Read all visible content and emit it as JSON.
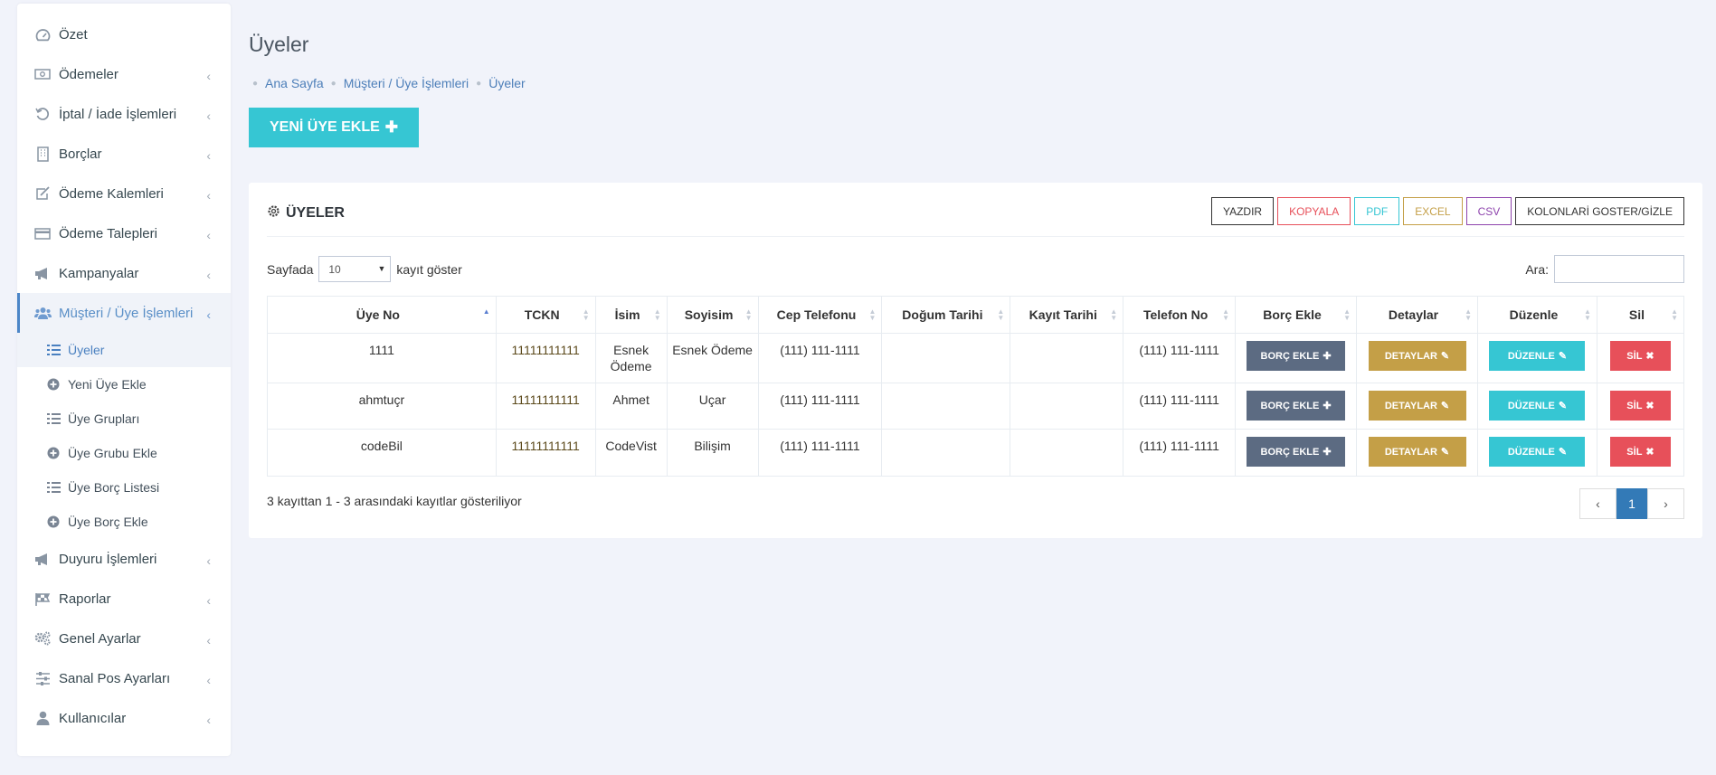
{
  "sidebar": {
    "items": [
      {
        "label": "Özet",
        "icon": "dashboard-icon"
      },
      {
        "label": "Ödemeler",
        "icon": "money-icon"
      },
      {
        "label": "İptal / İade İşlemleri",
        "icon": "undo-icon"
      },
      {
        "label": "Borçlar",
        "icon": "building-icon"
      },
      {
        "label": "Ödeme Kalemleri",
        "icon": "edit-icon"
      },
      {
        "label": "Ödeme Talepleri",
        "icon": "credit-card-icon"
      },
      {
        "label": "Kampanyalar",
        "icon": "megaphone-icon"
      },
      {
        "label": "Müşteri / Üye İşlemleri",
        "icon": "users-icon"
      },
      {
        "label": "Duyuru İşlemleri",
        "icon": "megaphone-icon"
      },
      {
        "label": "Raporlar",
        "icon": "flag-icon"
      },
      {
        "label": "Genel Ayarlar",
        "icon": "cogs-icon"
      },
      {
        "label": "Sanal Pos Ayarları",
        "icon": "sliders-icon"
      },
      {
        "label": "Kullanıcılar",
        "icon": "user-icon"
      }
    ],
    "sub_items": [
      {
        "label": "Üyeler",
        "icon": "list-icon"
      },
      {
        "label": "Yeni Üye Ekle",
        "icon": "plus-circle-icon"
      },
      {
        "label": "Üye Grupları",
        "icon": "list-icon"
      },
      {
        "label": "Üye Grubu Ekle",
        "icon": "plus-circle-icon"
      },
      {
        "label": "Üye Borç Listesi",
        "icon": "list-icon"
      },
      {
        "label": "Üye Borç Ekle",
        "icon": "plus-circle-icon"
      }
    ]
  },
  "page": {
    "title": "Üyeler",
    "breadcrumb": [
      "Ana Sayfa",
      "Müşteri / Üye İşlemleri",
      "Üyeler"
    ],
    "new_button": "YENİ ÜYE EKLE"
  },
  "card": {
    "title": "ÜYELER",
    "tools": [
      {
        "label": "YAZDIR",
        "color": "#333333"
      },
      {
        "label": "KOPYALA",
        "color": "#e7505a"
      },
      {
        "label": "PDF",
        "color": "#36c6d3"
      },
      {
        "label": "EXCEL",
        "color": "#c49f47"
      },
      {
        "label": "CSV",
        "color": "#8e44ad"
      },
      {
        "label": "KOLONLARİ GOSTER/GİZLE",
        "color": "#333333"
      }
    ],
    "length_prefix": "Sayfada",
    "length_value": "10",
    "length_suffix": "kayıt göster",
    "search_label": "Ara:",
    "info": "3 kayıttan 1 - 3 arasındaki kayıtlar gösteriliyor",
    "current_page": "1"
  },
  "table": {
    "columns": [
      "Üye No",
      "TCKN",
      "İsim",
      "Soyisim",
      "Cep Telefonu",
      "Doğum Tarihi",
      "Kayıt Tarihi",
      "Telefon No",
      "Borç Ekle",
      "Detaylar",
      "Düzenle",
      "Sil"
    ],
    "rows": [
      {
        "uye_no": "1111",
        "tckn": "11111111111",
        "isim": "Esnek Ödeme",
        "soyisim": "Esnek Ödeme",
        "cep": "(111) 111-1111",
        "dogum": "",
        "kayit": "",
        "tel": "(111) 111-1111"
      },
      {
        "uye_no": "ahmtuçr",
        "tckn": "11111111111",
        "isim": "Ahmet",
        "soyisim": "Uçar",
        "cep": "(111) 111-1111",
        "dogum": "",
        "kayit": "",
        "tel": "(111) 111-1111"
      },
      {
        "uye_no": "codeBil",
        "tckn": "11111111111",
        "isim": "CodeVist",
        "soyisim": "Bilişim",
        "cep": "(111) 111-1111",
        "dogum": "",
        "kayit": "",
        "tel": "(111) 111-1111"
      }
    ],
    "actions": {
      "borc": "BORÇ EKLE",
      "detay": "DETAYLAR",
      "duzenle": "DÜZENLE",
      "sil": "SİL"
    }
  }
}
